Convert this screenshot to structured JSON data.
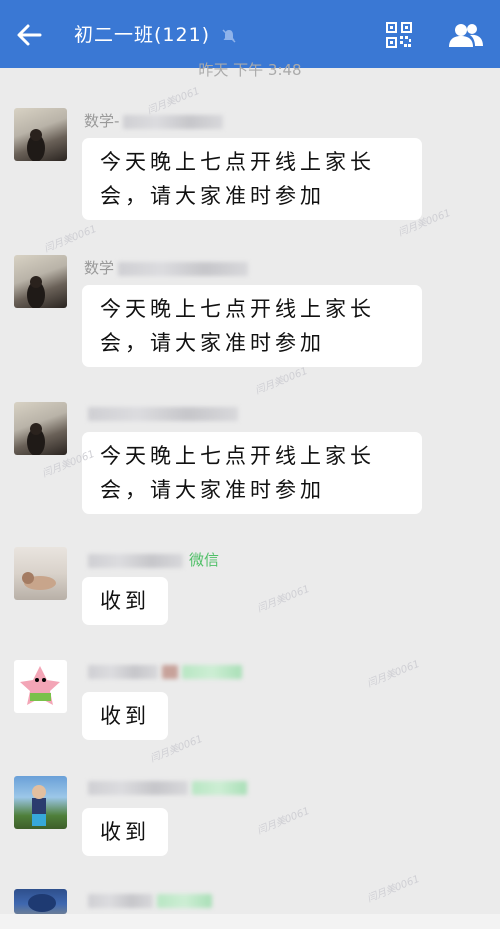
{
  "header": {
    "title": "初二一班(121)"
  },
  "timestamp": "昨天 下午 3:48",
  "messages": [
    {
      "sender_visible": "数学-",
      "text": "今天晚上七点开线上家长会，请大家准时参加"
    },
    {
      "sender_visible": "数学",
      "text": "今天晚上七点开线上家长会，请大家准时参加"
    },
    {
      "sender_visible": "",
      "text": "今天晚上七点开线上家长会，请大家准时参加"
    },
    {
      "sender_visible": "微信",
      "text": "收到"
    },
    {
      "sender_visible": "",
      "text": "收到"
    },
    {
      "sender_visible": "",
      "text": "收到"
    },
    {
      "sender_visible": "",
      "text": ""
    }
  ],
  "watermark_text": "闫月美0061",
  "colors": {
    "header": "#3a78d4",
    "background": "#ebebeb",
    "bubble": "#ffffff"
  },
  "icons": [
    "back-arrow-icon",
    "mute-bell-icon",
    "qr-code-icon",
    "group-members-icon"
  ]
}
